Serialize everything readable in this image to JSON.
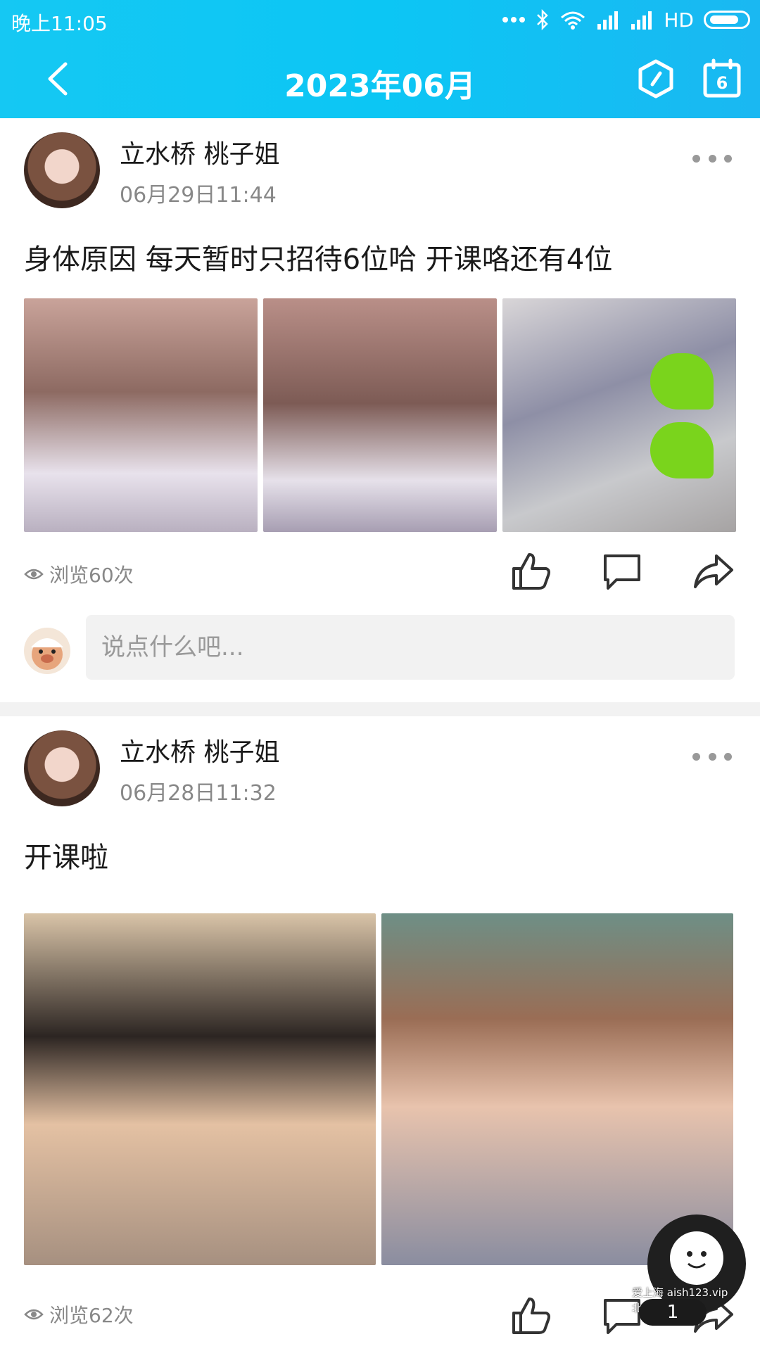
{
  "status_bar": {
    "time": "晚上11:05",
    "network": "HD"
  },
  "header": {
    "title": "2023年06月",
    "calendar_day": "6"
  },
  "posts": [
    {
      "author": "立水桥 桃子姐",
      "time": "06月29日11:44",
      "text": "身体原因 每天暂时只招待6位哈 开课咯还有4位",
      "photo_count": 3,
      "views": "浏览60次"
    },
    {
      "author": "立水桥 桃子姐",
      "time": "06月28日11:32",
      "text": "开课啦",
      "photo_count": 2,
      "views": "浏览62次"
    }
  ],
  "comment": {
    "placeholder": "说点什么吧..."
  },
  "floating": {
    "badge": "1",
    "watermark_1": "爱上海 aish123.vip",
    "watermark_2": "北京 aibj.fun"
  },
  "colors": {
    "header": "#0cc6f4",
    "divider": "#f2f2f2",
    "meta_text": "#888888"
  }
}
